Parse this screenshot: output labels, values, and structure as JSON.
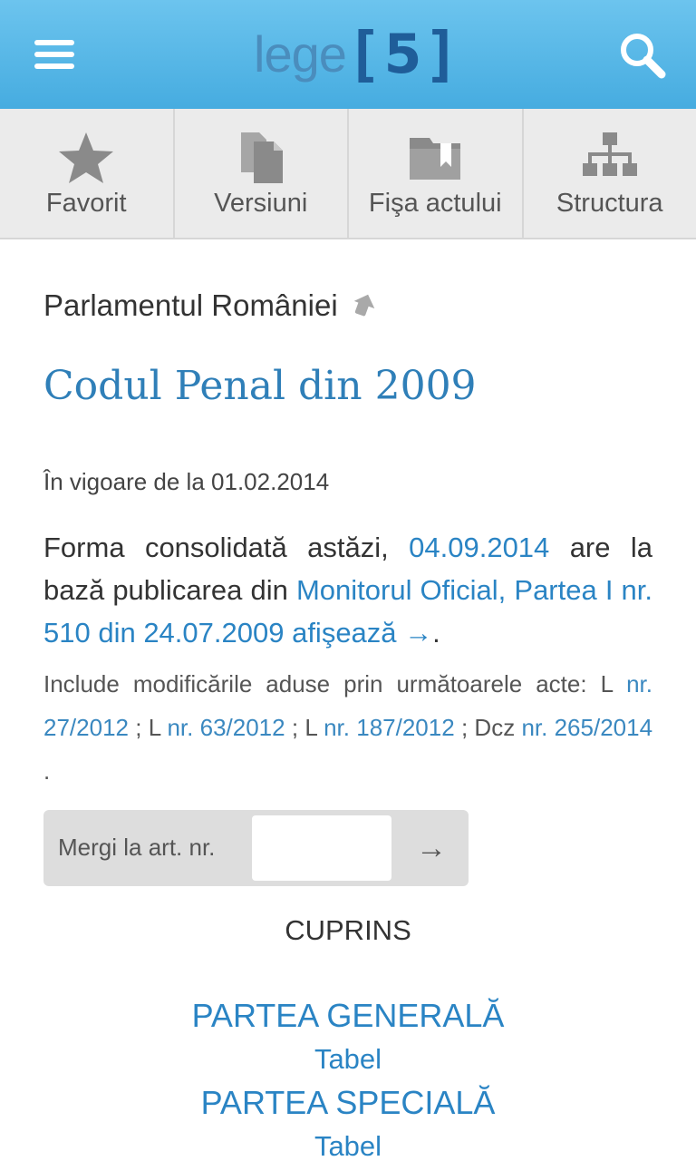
{
  "header": {
    "logo_word": "lege",
    "logo_bracket_left": "[",
    "logo_number": "5",
    "logo_bracket_right": "]",
    "menu_icon": "hamburger-menu-icon",
    "search_icon": "search-icon",
    "bg_color": "#5ab8e8"
  },
  "tabs": [
    {
      "label": "Favorit",
      "icon": "star-icon"
    },
    {
      "label": "Versiuni",
      "icon": "documents-icon"
    },
    {
      "label": "Fişa actului",
      "icon": "folder-bookmark-icon"
    },
    {
      "label": "Structura",
      "icon": "hierarchy-icon"
    }
  ],
  "document": {
    "issuer": "Parlamentul României",
    "title": "Codul Penal din 2009",
    "vigoare_prefix": "În vigoare de la",
    "vigoare_date": "01.02.2014",
    "consol_prefix": "Forma consolidată astăzi,",
    "consol_date": "04.09.2014",
    "consol_mid": "are la bază publicarea din",
    "consol_link": "Monitorul Oficial, Partea I nr. 510 din 24.07.2009 afişează →",
    "consol_end": ".",
    "mods_prefix": "Include modificările aduse prin următoarele acte:",
    "mods": [
      {
        "type": "L",
        "link": "nr. 27/2012",
        "sep": ";"
      },
      {
        "type": "L",
        "link": "nr. 63/2012",
        "sep": ";"
      },
      {
        "type": "L",
        "link": "nr. 187/2012",
        "sep": ";"
      },
      {
        "type": "Dcz",
        "link": "nr. 265/2014",
        "sep": "."
      }
    ],
    "link_color": "#2a84c4"
  },
  "goto": {
    "label": "Mergi la art. nr.",
    "input_value": "",
    "button": "→"
  },
  "toc": {
    "heading": "CUPRINS",
    "items": [
      {
        "part": "PARTEA GENERALĂ",
        "sub": "Tabel"
      },
      {
        "part": "PARTEA SPECIALĂ",
        "sub": "Tabel"
      }
    ]
  }
}
